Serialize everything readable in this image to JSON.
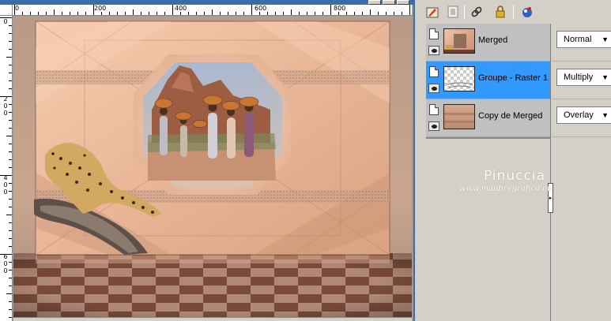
{
  "canvas": {
    "ruler_top_labels": [
      "0",
      "200",
      "400",
      "600",
      "800"
    ],
    "ruler_left_labels": [
      "0",
      "200",
      "400",
      "600"
    ],
    "colors": {
      "ruler_bg": "#ffffff",
      "frame": "#3a6ea5",
      "scene_tone": "#e8b899"
    }
  },
  "toolbar": {
    "icons": [
      "brush-icon",
      "layer-mask-icon",
      "link-icon",
      "lock-icon",
      "palette-icon"
    ]
  },
  "layers": [
    {
      "name": "Merged",
      "blend_mode": "Normal",
      "selected": false
    },
    {
      "name": "Groupe - Raster 1",
      "blend_mode": "Multiply",
      "selected": true
    },
    {
      "name": "Copy de Merged",
      "blend_mode": "Overlay",
      "selected": false
    }
  ],
  "watermark": {
    "title": "Pinuccia",
    "site": "www.maidiregrafica.eu"
  },
  "colors": {
    "selection": "#3399ff",
    "panel": "#d4d0c8"
  }
}
